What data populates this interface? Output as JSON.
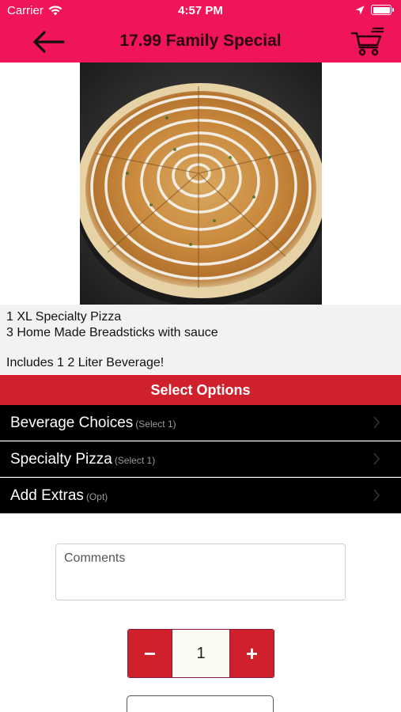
{
  "status_bar": {
    "carrier": "Carrier",
    "time": "4:57 PM",
    "icons": [
      "wifi-icon",
      "location-arrow-icon",
      "battery-icon"
    ]
  },
  "nav": {
    "title": "17.99 Family Special",
    "back_icon": "arrow-left-icon",
    "cart_icon": "cart-icon",
    "color": "#f0145a"
  },
  "product": {
    "image": "pizza-photo",
    "description_lines": [
      "1 XL Specialty Pizza",
      "3 Home Made Breadsticks with sauce",
      "",
      "Includes 1 2 Liter Beverage!"
    ]
  },
  "options": {
    "header": "Select Options",
    "rows": [
      {
        "label": "Beverage Choices",
        "hint": "(Select 1)"
      },
      {
        "label": "Specialty Pizza",
        "hint": "(Select 1)"
      },
      {
        "label": "Add Extras",
        "hint": "(Opt)"
      }
    ]
  },
  "comments": {
    "placeholder": "Comments",
    "value": ""
  },
  "quantity": {
    "minus": "−",
    "value": "1",
    "plus": "+"
  },
  "accent": "#d0202c"
}
